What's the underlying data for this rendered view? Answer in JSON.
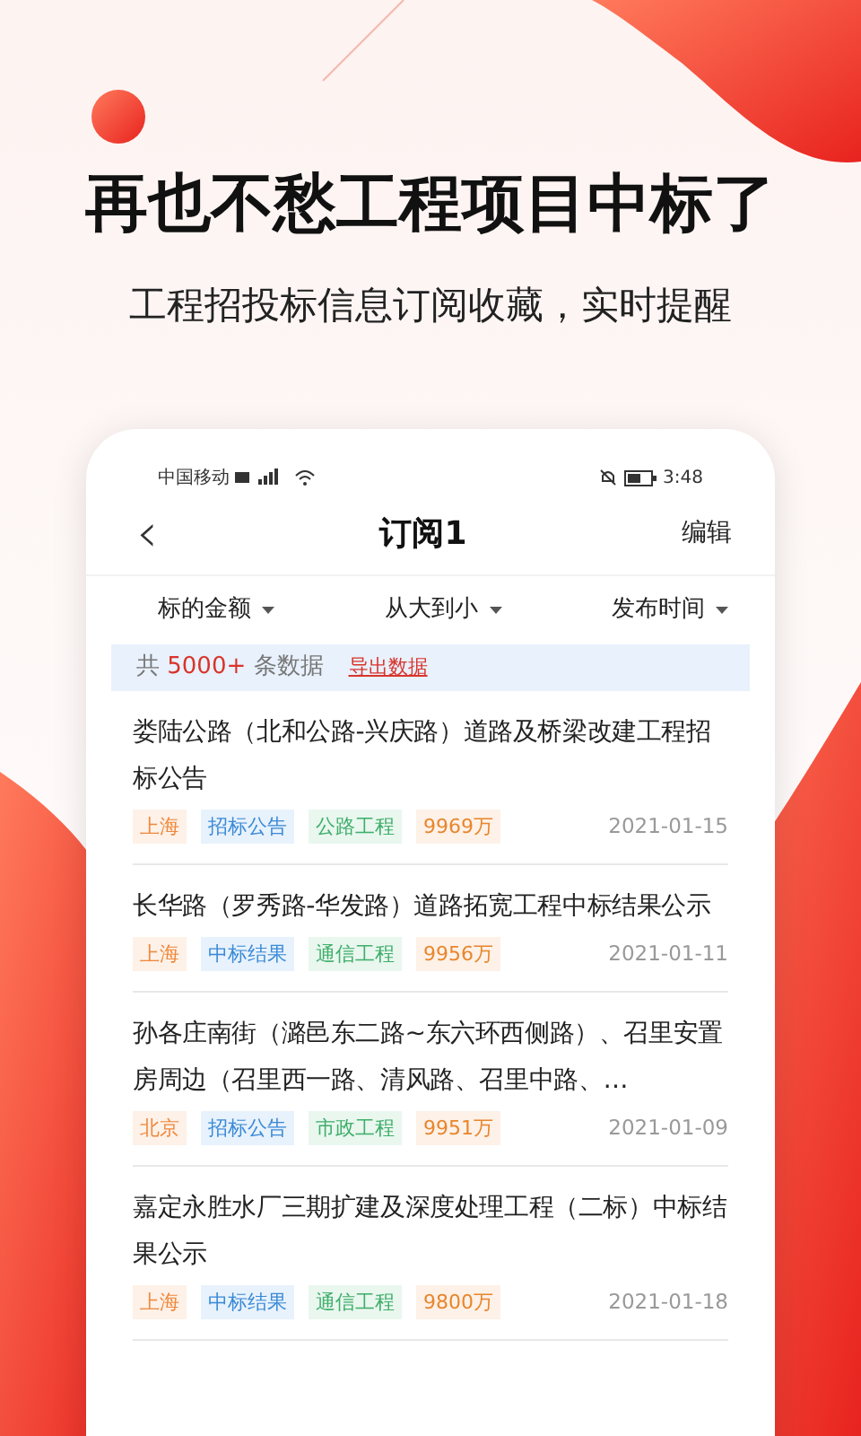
{
  "headline": "再也不愁工程项目中标了",
  "subtitle": "工程招投标信息订阅收藏，实时提醒",
  "status_bar": {
    "carrier": "中国移动",
    "time": "3:48"
  },
  "nav": {
    "back": "‹",
    "title": "订阅1",
    "action": "编辑"
  },
  "filters": [
    {
      "label": "标的金额"
    },
    {
      "label": "从大到小"
    },
    {
      "label": "发布时间"
    }
  ],
  "summary": {
    "prefix": "共",
    "count": "5000+",
    "suffix": "条数据",
    "export": "导出数据"
  },
  "items": [
    {
      "title": "娄陆公路（北和公路-兴庆路）道路及桥梁改建工程招标公告",
      "tags": [
        "上海",
        "招标公告",
        "公路工程",
        "9969万"
      ],
      "date": "2021-01-15"
    },
    {
      "title": "长华路（罗秀路-华发路）道路拓宽工程中标结果公示",
      "tags": [
        "上海",
        "中标结果",
        "通信工程",
        "9956万"
      ],
      "date": "2021-01-11"
    },
    {
      "title": "孙各庄南街（潞邑东二路~东六环西侧路）、召里安置房周边（召里西一路、清风路、召里中路、…",
      "tags": [
        "北京",
        "招标公告",
        "市政工程",
        "9951万"
      ],
      "date": "2021-01-09"
    },
    {
      "title": "嘉定永胜水厂三期扩建及深度处理工程（二标）中标结果公示",
      "tags": [
        "上海",
        "中标结果",
        "通信工程",
        "9800万"
      ],
      "date": "2021-01-18"
    }
  ]
}
